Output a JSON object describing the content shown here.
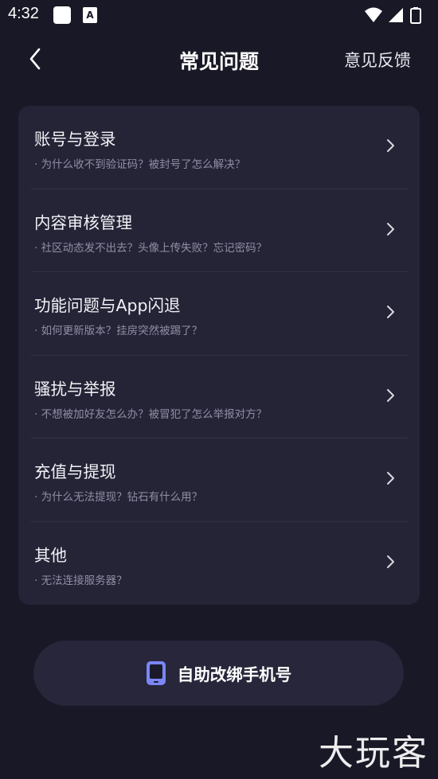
{
  "status_bar": {
    "time": "4:32",
    "a_glyph": "A"
  },
  "header": {
    "title": "常见问题",
    "feedback_label": "意见反馈"
  },
  "faq": {
    "items": [
      {
        "title": "账号与登录",
        "subtitle": "· 为什么收不到验证码？被封号了怎么解决？"
      },
      {
        "title": "内容审核管理",
        "subtitle": "· 社区动态发不出去？头像上传失败？忘记密码？"
      },
      {
        "title": "功能问题与App闪退",
        "subtitle": "· 如何更新版本？挂房突然被踢了？"
      },
      {
        "title": "骚扰与举报",
        "subtitle": "· 不想被加好友怎么办？被冒犯了怎么举报对方？"
      },
      {
        "title": "充值与提现",
        "subtitle": "· 为什么无法提现？钻石有什么用？"
      },
      {
        "title": "其他",
        "subtitle": "· 无法连接服务器？"
      }
    ]
  },
  "rebind": {
    "label": "自助改绑手机号"
  },
  "watermark": "大玩客",
  "colors": {
    "background": "#191826",
    "card": "#252437",
    "accent_phone": "#7b86f5"
  },
  "icons": [
    "back-arrow-icon",
    "chevron-right-icon",
    "phone-icon",
    "wifi-icon",
    "signal-icon",
    "battery-icon"
  ]
}
